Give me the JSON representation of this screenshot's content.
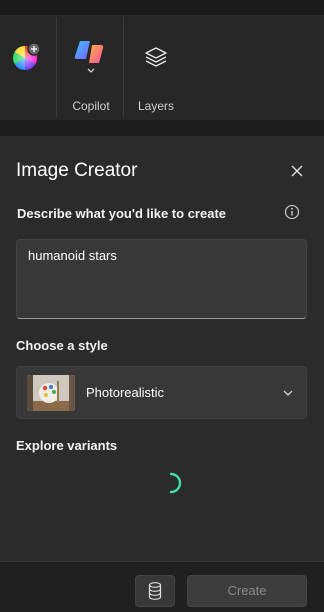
{
  "ribbon": {
    "color_button_icon": "color-wheel-icon",
    "copilot_label": "Copilot",
    "layers_label": "Layers"
  },
  "panel": {
    "title": "Image Creator",
    "describe_label": "Describe what you'd like to create",
    "prompt_value": "humanoid stars",
    "style_label": "Choose a style",
    "style_value": "Photorealistic",
    "variants_label": "Explore variants",
    "spinner_color": "#3de0a0"
  },
  "footer": {
    "create_label": "Create"
  }
}
